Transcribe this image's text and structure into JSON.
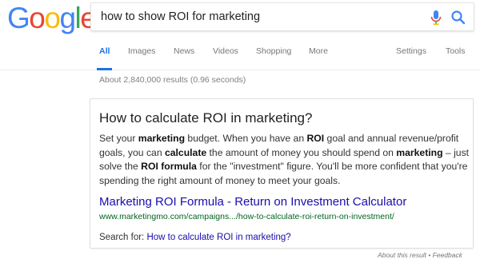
{
  "logo": {
    "text": "Google",
    "letters": [
      "G",
      "o",
      "o",
      "g",
      "l",
      "e"
    ],
    "colors": [
      "#4285F4",
      "#EA4335",
      "#FBBC05",
      "#4285F4",
      "#34A853",
      "#EA4335"
    ]
  },
  "search": {
    "query": "how to show ROI for marketing"
  },
  "tabs": [
    {
      "label": "All",
      "active": true
    },
    {
      "label": "Images"
    },
    {
      "label": "News"
    },
    {
      "label": "Videos"
    },
    {
      "label": "Shopping"
    },
    {
      "label": "More"
    },
    {
      "label": "Settings"
    },
    {
      "label": "Tools"
    }
  ],
  "results_stats": "About 2,840,000 results (0.96 seconds)",
  "featured_snippet": {
    "title": "How to calculate ROI in marketing?",
    "snippet_parts": [
      {
        "text": "Set your ",
        "bold": false
      },
      {
        "text": "marketing",
        "bold": true
      },
      {
        "text": " budget. When you have an ",
        "bold": false
      },
      {
        "text": "ROI",
        "bold": true
      },
      {
        "text": " goal and annual revenue/profit goals, you can ",
        "bold": false
      },
      {
        "text": "calculate",
        "bold": true
      },
      {
        "text": " the amount of money you should spend on ",
        "bold": false
      },
      {
        "text": "marketing",
        "bold": true
      },
      {
        "text": " – just solve the ",
        "bold": false
      },
      {
        "text": "ROI formula",
        "bold": true
      },
      {
        "text": " for the \"investment\" figure. You'll be more confident that you're spending the right amount of money to meet your goals.",
        "bold": false
      }
    ],
    "link_title": "Marketing ROI Formula - Return on Investment Calculator",
    "link_url": "www.marketingmo.com/campaigns.../how-to-calculate-roi-return-on-investment/",
    "search_for_label": "Search for: ",
    "search_for_link": "How to calculate ROI in marketing?"
  },
  "footer": {
    "about": "About this result",
    "separator": " • ",
    "feedback": "Feedback"
  },
  "colors": {
    "link": "#1a0dab",
    "url": "#006621",
    "active_tab": "#1a73e8"
  },
  "icons": {
    "mic": "microphone-icon",
    "search": "search-icon"
  }
}
